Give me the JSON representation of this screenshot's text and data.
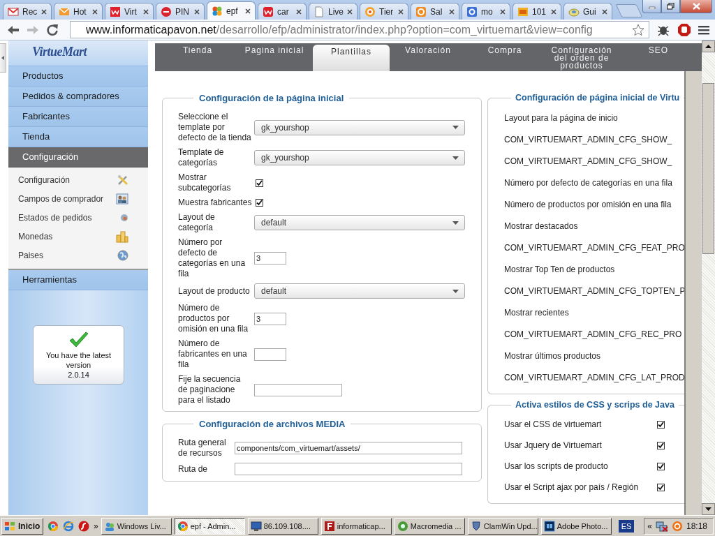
{
  "browser": {
    "tabs": [
      {
        "title": "Rec",
        "selected": false
      },
      {
        "title": "Hot",
        "selected": false
      },
      {
        "title": "Virt",
        "selected": false
      },
      {
        "title": "PIN",
        "selected": false
      },
      {
        "title": "epf",
        "selected": true
      },
      {
        "title": "car",
        "selected": false
      },
      {
        "title": "Live",
        "selected": false
      },
      {
        "title": "Tier",
        "selected": false
      },
      {
        "title": "Sal",
        "selected": false
      },
      {
        "title": "mo",
        "selected": false
      },
      {
        "title": "101",
        "selected": false
      },
      {
        "title": "Gui",
        "selected": false
      }
    ],
    "url_host": "www.informaticapavon.net",
    "url_path": "/desarrollo/efp/administrator/index.php?option=com_virtuemart&view=config"
  },
  "sidebar": {
    "logo": "VirtueMart",
    "menu": [
      {
        "label": "Productos",
        "selected": false
      },
      {
        "label": "Pedidos & compradores",
        "selected": false
      },
      {
        "label": "Fabricantes",
        "selected": false
      },
      {
        "label": "Tienda",
        "selected": false
      },
      {
        "label": "Configuración",
        "selected": true,
        "children": [
          {
            "label": "Configuración"
          },
          {
            "label": "Campos de comprador"
          },
          {
            "label": "Estados de pedidos"
          },
          {
            "label": "Monedas"
          },
          {
            "label": "Paises"
          }
        ]
      },
      {
        "label": "Herramientas",
        "selected": false
      }
    ],
    "version_box": {
      "message": "You have the latest version",
      "version": "2.0.14"
    }
  },
  "config": {
    "tabs": [
      {
        "label": "Tienda",
        "selected": false
      },
      {
        "label": "Pagina inicial",
        "selected": false
      },
      {
        "label": "Plantillas",
        "selected": true
      },
      {
        "label": "Valoración",
        "selected": false
      },
      {
        "label": "Compra",
        "selected": false
      },
      {
        "label": "Configuración del orden de productos",
        "selected": false
      },
      {
        "label": "SEO",
        "selected": false
      }
    ],
    "left_column": [
      {
        "title": "Configuración de la página inicial",
        "rows": [
          {
            "label": "Seleccione el template por defecto de la tienda",
            "kind": "select",
            "value": "gk_yourshop"
          },
          {
            "label": "Template de categorías",
            "kind": "select",
            "value": "gk_yourshop"
          },
          {
            "label": "Mostrar subcategorías",
            "kind": "checkbox",
            "checked": true
          },
          {
            "label": "Muestra fabricantes",
            "kind": "checkbox",
            "checked": true
          },
          {
            "label": "Layout de categoría",
            "kind": "select",
            "value": "default"
          },
          {
            "label": "Número por defecto de categorías en una fila",
            "kind": "number",
            "value": "3"
          },
          {
            "label": "Layout de producto",
            "kind": "select",
            "value": "default"
          },
          {
            "label": "Número de productos por omisión en una fila",
            "kind": "number",
            "value": "3"
          },
          {
            "label": "Número de fabricantes en una fila",
            "kind": "number"
          },
          {
            "label": "Fije la secuencia de paginacione para el listado",
            "kind": "text"
          }
        ]
      },
      {
        "title": "Configuración de archivos MEDIA",
        "rows": [
          {
            "label": "Ruta general de recursos",
            "kind": "path",
            "value": "components/com_virtuemart/assets/"
          },
          {
            "label": "Ruta de",
            "kind": "path"
          }
        ]
      }
    ],
    "right_column": [
      {
        "title": "Configuración de página inicial de Virtu",
        "rows": [
          {
            "label": "Layout para la página de inicio",
            "kind": "info"
          },
          {
            "label": "COM_VIRTUEMART_ADMIN_CFG_SHOW_",
            "kind": "info"
          },
          {
            "label": "COM_VIRTUEMART_ADMIN_CFG_SHOW_",
            "kind": "info"
          },
          {
            "label": "Número por defecto de categorías en una fila",
            "kind": "info"
          },
          {
            "label": "Número de productos por omisión en una fila",
            "kind": "info"
          },
          {
            "label": "Mostrar destacados",
            "kind": "info"
          },
          {
            "label": "COM_VIRTUEMART_ADMIN_CFG_FEAT_PRO",
            "kind": "info"
          },
          {
            "label": "Mostrar Top Ten de productos",
            "kind": "info"
          },
          {
            "label": "COM_VIRTUEMART_ADMIN_CFG_TOPTEN_P",
            "kind": "info"
          },
          {
            "label": "Mostrar recientes",
            "kind": "info"
          },
          {
            "label": "COM_VIRTUEMART_ADMIN_CFG_REC_PRO",
            "kind": "info"
          },
          {
            "label": "Mostrar últimos productos",
            "kind": "info"
          },
          {
            "label": "COM_VIRTUEMART_ADMIN_CFG_LAT_PROD",
            "kind": "info"
          }
        ]
      },
      {
        "title": "Activa estilos de CSS y scrips de Java",
        "rows": [
          {
            "label": "Usar el CSS de virtuemart",
            "kind": "checkbox",
            "checked": true
          },
          {
            "label": "Usar Jquery de Virtuemart",
            "kind": "checkbox",
            "checked": true
          },
          {
            "label": "Usar los scripts de producto",
            "kind": "checkbox",
            "checked": true
          },
          {
            "label": "Usar el Script ajax por país / Región",
            "kind": "checkbox",
            "checked": true
          }
        ]
      }
    ]
  },
  "taskbar": {
    "start": "Inicio",
    "quick_more": "»",
    "items": [
      {
        "label": "Windows Liv...",
        "selected": false
      },
      {
        "label": "epf - Admin...",
        "selected": true
      },
      {
        "label": "86.109.108....",
        "selected": false
      },
      {
        "label": "informaticap...",
        "selected": false
      },
      {
        "label": "Macromedia ...",
        "selected": false
      },
      {
        "label": "ClamWin Upd...",
        "selected": false
      },
      {
        "label": "Adobe Photo...",
        "selected": false
      }
    ],
    "language": "ES",
    "tray_expand": "«",
    "time": "18:18"
  }
}
